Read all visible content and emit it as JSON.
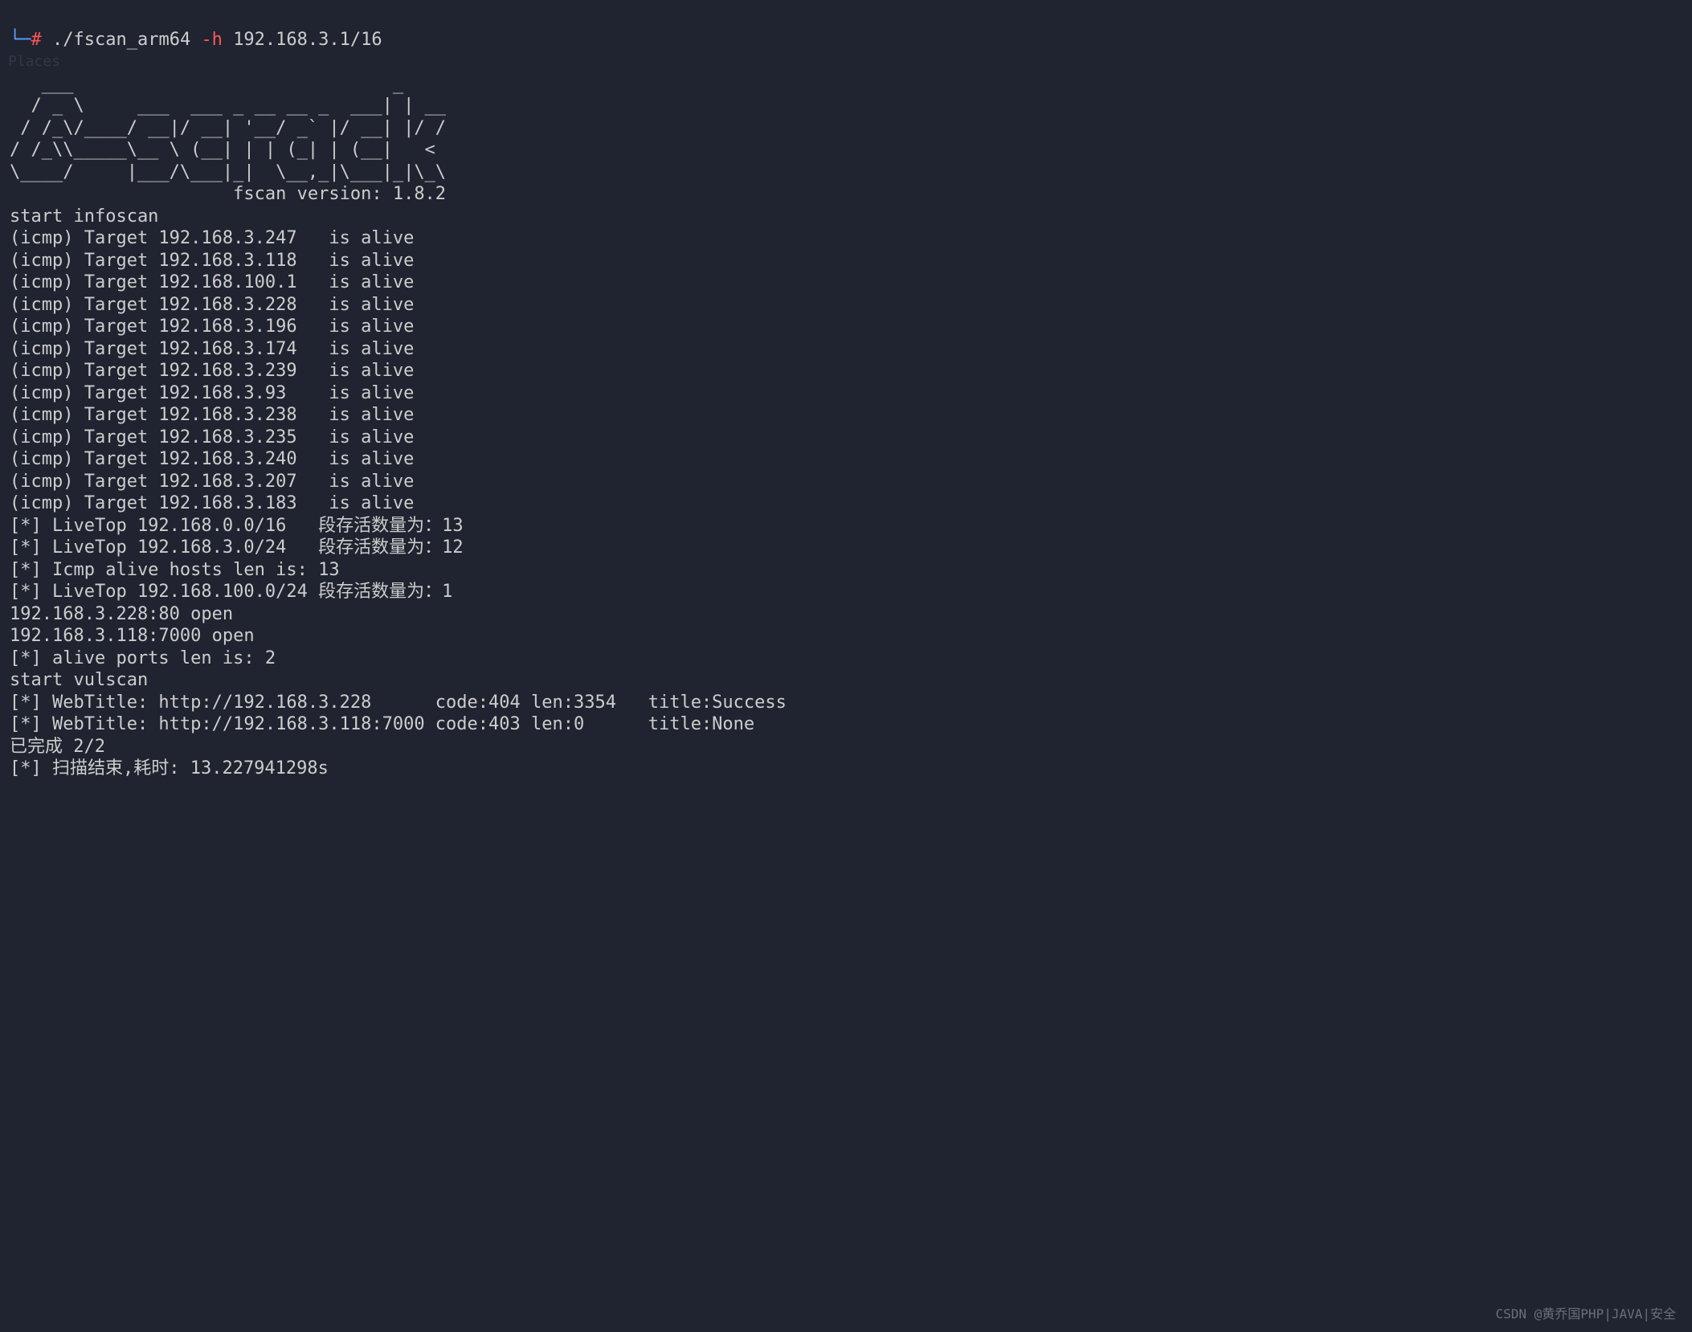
{
  "prompt": {
    "arrow": "└─",
    "hash": "#",
    "cmd_path": "./fscan_arm64",
    "cmd_flag": "-h",
    "cmd_arg": "192.168.3.1/16"
  },
  "ascii_art": [
    "   ___                              _",
    "  / _ \\     ___  ___ _ __ __ _  ___| | __",
    " / /_\\/____/ __|/ __| '__/ _` |/ __| |/ /",
    "/ /_\\\\_____\\__ \\ (__| | | (_| | (__|   <",
    "\\____/     |___/\\___|_|  \\__,_|\\___|_|\\_\\"
  ],
  "version_line": "                     fscan version: 1.8.2",
  "start_infoscan": "start infoscan",
  "icmp_lines": [
    "(icmp) Target 192.168.3.247   is alive",
    "(icmp) Target 192.168.3.118   is alive",
    "(icmp) Target 192.168.100.1   is alive",
    "(icmp) Target 192.168.3.228   is alive",
    "(icmp) Target 192.168.3.196   is alive",
    "(icmp) Target 192.168.3.174   is alive",
    "(icmp) Target 192.168.3.239   is alive",
    "(icmp) Target 192.168.3.93    is alive",
    "(icmp) Target 192.168.3.238   is alive",
    "(icmp) Target 192.168.3.235   is alive",
    "(icmp) Target 192.168.3.240   is alive",
    "(icmp) Target 192.168.3.207   is alive",
    "(icmp) Target 192.168.3.183   is alive"
  ],
  "summary_lines": [
    "[*] LiveTop 192.168.0.0/16   段存活数量为：13",
    "[*] LiveTop 192.168.3.0/24   段存活数量为：12",
    "[*] Icmp alive hosts len is: 13",
    "[*] LiveTop 192.168.100.0/24 段存活数量为：1"
  ],
  "port_lines": [
    "192.168.3.228:80 open",
    "192.168.3.118:7000 open",
    "[*] alive ports len is: 2"
  ],
  "start_vulscan": "start vulscan",
  "web_lines": [
    "[*] WebTitle: http://192.168.3.228      code:404 len:3354   title:Success",
    "[*] WebTitle: http://192.168.3.118:7000 code:403 len:0      title:None"
  ],
  "done_line": "已完成 2/2",
  "end_line": "[*] 扫描结束,耗时: 13.227941298s",
  "watermark": "CSDN @黄乔国PHP|JAVA|安全",
  "ghost_places": "Places"
}
